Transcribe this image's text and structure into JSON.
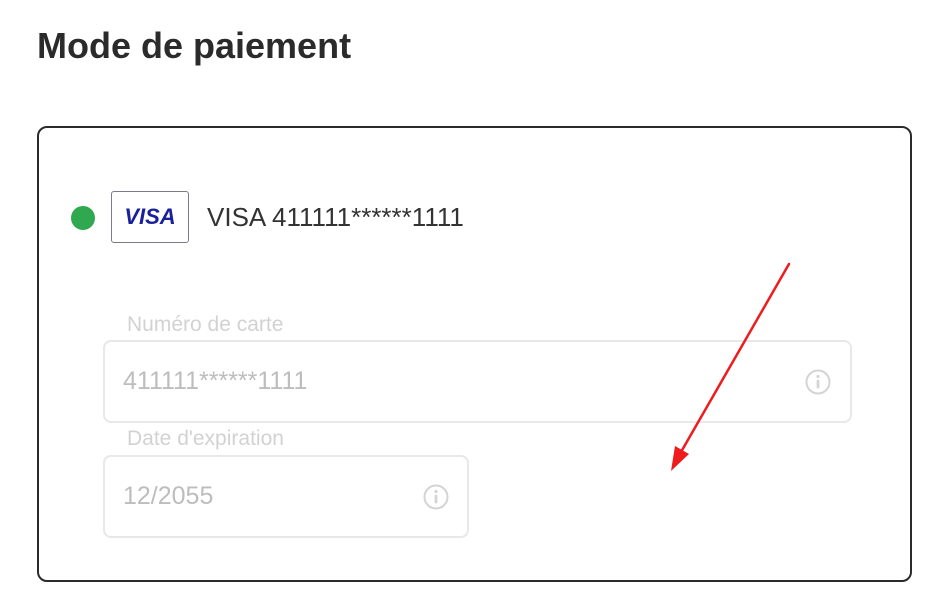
{
  "page": {
    "title": "Mode de paiement"
  },
  "payment_method": {
    "selected": true,
    "brand_icon": "visa-logo",
    "brand_logo_text": "VISA",
    "summary": "VISA 411111******1111",
    "status_color": "#2fa84f"
  },
  "fields": {
    "card_number": {
      "label": "Numéro de carte",
      "value": "411111******1111",
      "icon": "info-icon"
    },
    "expiration": {
      "label": "Date d'expiration",
      "value": "12/2055",
      "icon": "info-icon"
    }
  },
  "annotation": {
    "type": "arrow",
    "color": "#ee1c1c"
  }
}
